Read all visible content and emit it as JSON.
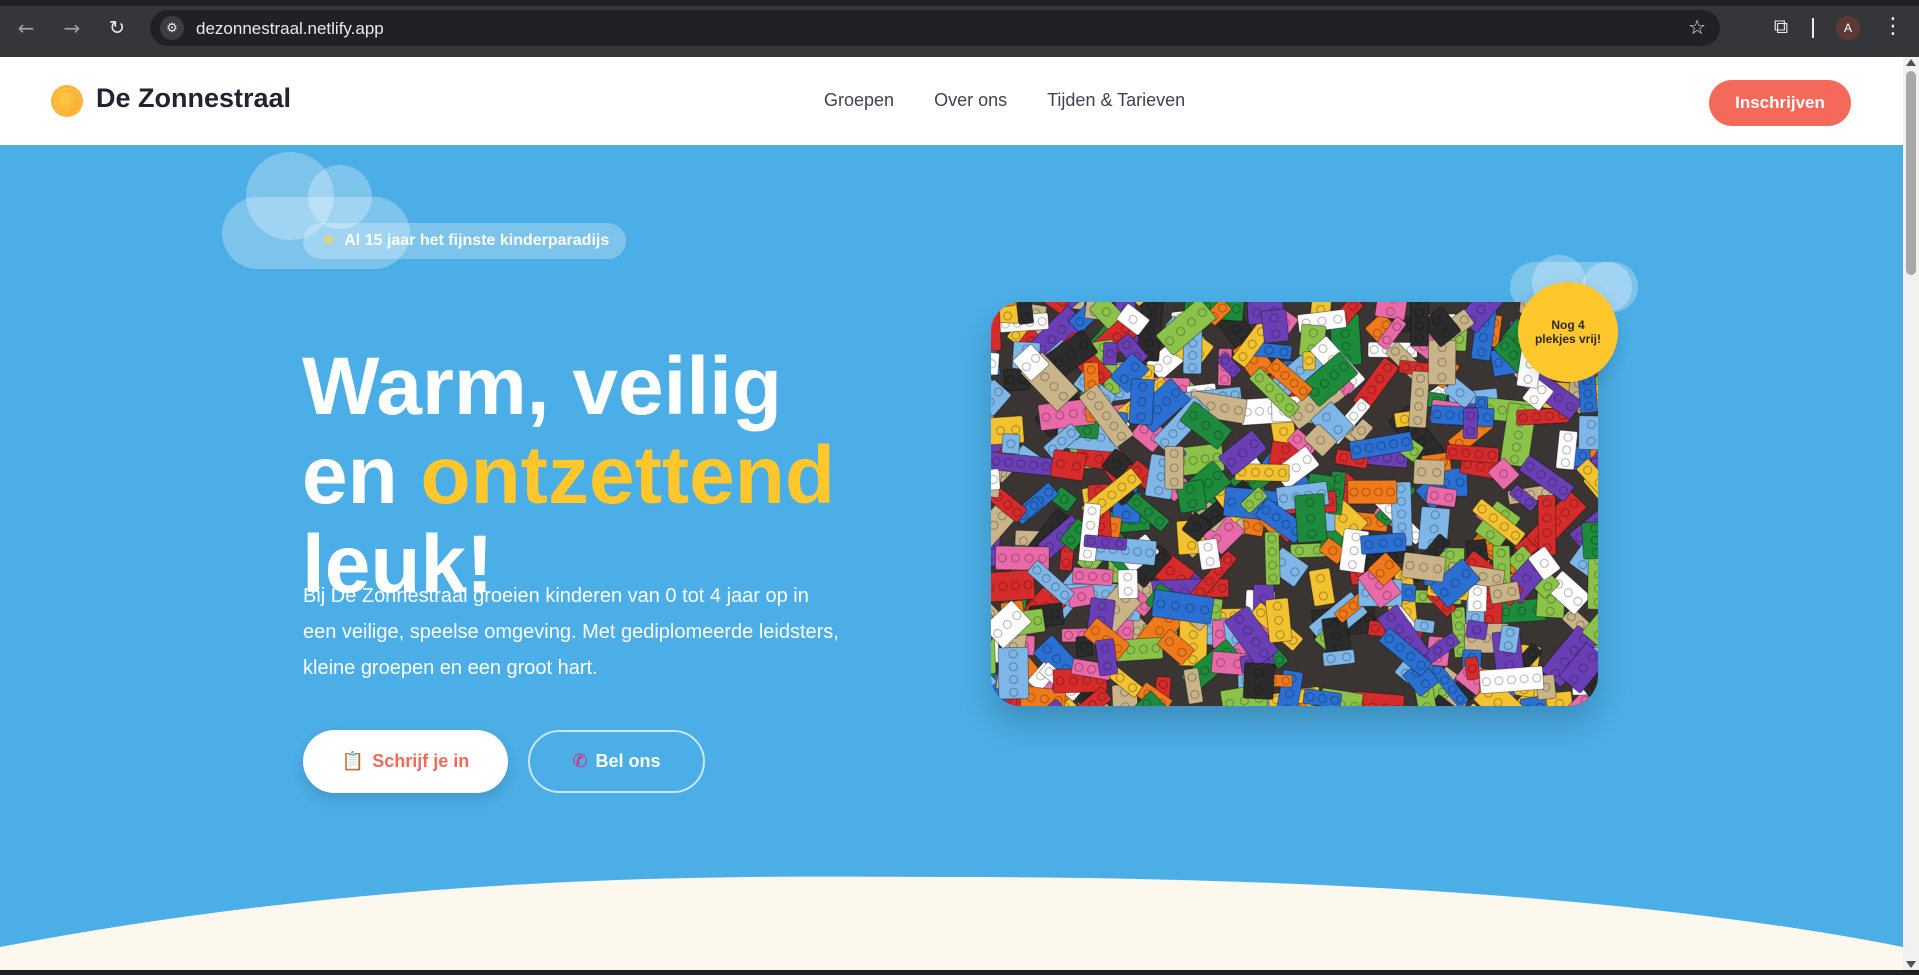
{
  "browser": {
    "url": "dezonnestraal.netlify.app",
    "back_icon": "arrow-left-icon",
    "forward_icon": "arrow-right-icon",
    "reload_icon": "reload-icon",
    "avatar_initial": "A"
  },
  "header": {
    "brand": "De Zonnestraal",
    "nav": [
      "Groepen",
      "Over ons",
      "Tijden & Tarieven"
    ],
    "cta": "Inschrijven"
  },
  "hero": {
    "badge": "Al 15 jaar het fijnste kinderparadijs",
    "headline_line1": "Warm, veilig",
    "headline_line2_pre": "en ",
    "headline_line2_accent": "ontzettend",
    "headline_line3": "leuk!",
    "lead": "Bij De Zonnestraal groeien kinderen van 0 tot 4 jaar op in een veilige, speelse omgeving. Met gediplomeerde leidsters, kleine groepen en een groot hart.",
    "primary_button": "Schrijf je in",
    "secondary_button": "Bel ons",
    "spots_badge": "Nog 4 plekjes vrij!"
  },
  "colors": {
    "hero_bg": "#4baee6",
    "accent_yellow": "#ffc72c",
    "coral": "#f4695a",
    "cream": "#fdf8ee"
  }
}
